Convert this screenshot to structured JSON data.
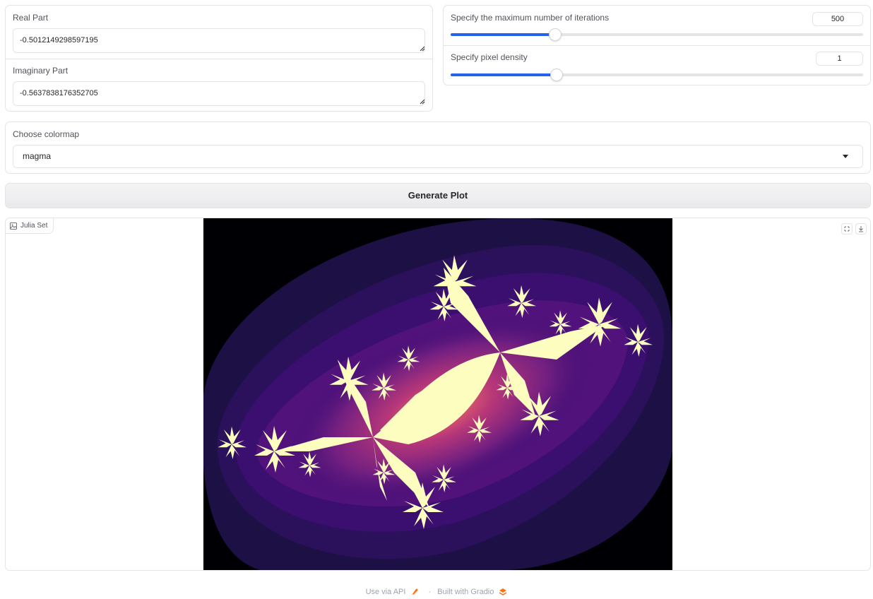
{
  "inputs": {
    "real_part": {
      "label": "Real Part",
      "value": "-0.5012149298597195"
    },
    "imaginary_part": {
      "label": "Imaginary Part",
      "value": "-0.5637838176352705"
    }
  },
  "sliders": {
    "iterations": {
      "label": "Specify the maximum number of iterations",
      "value": "500",
      "fraction": 0.254
    },
    "pixel_density": {
      "label": "Specify pixel density",
      "value": "1",
      "fraction": 0.257
    }
  },
  "colormap": {
    "label": "Choose colormap",
    "selected": "magma"
  },
  "generate_button": {
    "label": "Generate Plot"
  },
  "output": {
    "badge_label": "Julia Set"
  },
  "footer": {
    "api_label": "Use via API",
    "separator": "·",
    "built_label": "Built with Gradio"
  },
  "colors": {
    "accent": "#2563eb",
    "border": "#e4e4e7",
    "magma_dark": "#000004",
    "magma_deep": "#1c1044",
    "magma_purple": "#51127c",
    "magma_red": "#e7456b",
    "magma_light": "#fcfdbf"
  }
}
